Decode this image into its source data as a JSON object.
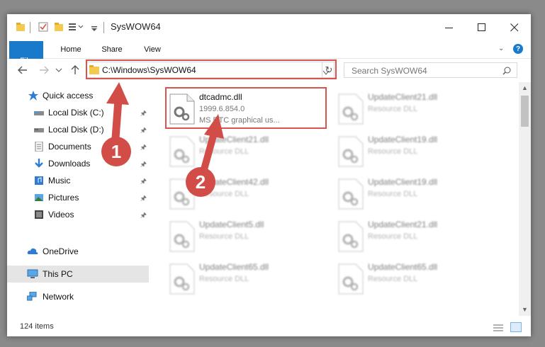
{
  "window": {
    "title": "SysWOW64"
  },
  "ribbon": {
    "tabs": [
      "File",
      "Home",
      "Share",
      "View"
    ]
  },
  "address": {
    "path": "C:\\Windows\\SysWOW64"
  },
  "search": {
    "placeholder": "Search SysWOW64"
  },
  "nav": {
    "items": [
      {
        "label": "Quick access",
        "icon": "star-icon"
      },
      {
        "label": "Local Disk (C:)",
        "icon": "drive-icon",
        "pinned": true
      },
      {
        "label": "Local Disk (D:)",
        "icon": "drive-icon",
        "pinned": true
      },
      {
        "label": "Documents",
        "icon": "document-icon",
        "pinned": true
      },
      {
        "label": "Downloads",
        "icon": "download-icon",
        "pinned": true
      },
      {
        "label": "Music",
        "icon": "music-icon",
        "pinned": true
      },
      {
        "label": "Pictures",
        "icon": "pictures-icon",
        "pinned": true
      },
      {
        "label": "Videos",
        "icon": "videos-icon",
        "pinned": true
      },
      {
        "label": "OneDrive",
        "icon": "cloud-icon"
      },
      {
        "label": "This PC",
        "icon": "pc-icon",
        "selected": true
      },
      {
        "label": "Network",
        "icon": "network-icon"
      }
    ]
  },
  "files": {
    "left": [
      {
        "name": "dtcadmc.dll",
        "line1": "1999.6.854.0",
        "line2": "MS DTC graphical us..."
      },
      {
        "name": "UpdateClient21.dll",
        "line1": "Resource DLL"
      },
      {
        "name": "UpdateClient42.dll",
        "line1": "Resource DLL"
      },
      {
        "name": "UpdateClient5.dll",
        "line1": "Resource DLL"
      },
      {
        "name": "UpdateClient65.dll",
        "line1": "Resource DLL"
      }
    ],
    "right": [
      {
        "name": "UpdateClient21.dll",
        "line1": "Resource DLL"
      },
      {
        "name": "UpdateClient19.dll",
        "line1": "Resource DLL"
      },
      {
        "name": "UpdateClient19.dll",
        "line1": "Resource DLL"
      },
      {
        "name": "UpdateClient21.dll",
        "line1": "Resource DLL"
      },
      {
        "name": "UpdateClient65.dll",
        "line1": "Resource DLL"
      }
    ]
  },
  "status": {
    "count": "124 items"
  },
  "annotations": {
    "step1": "1",
    "step2": "2",
    "color": "#d24d47"
  }
}
